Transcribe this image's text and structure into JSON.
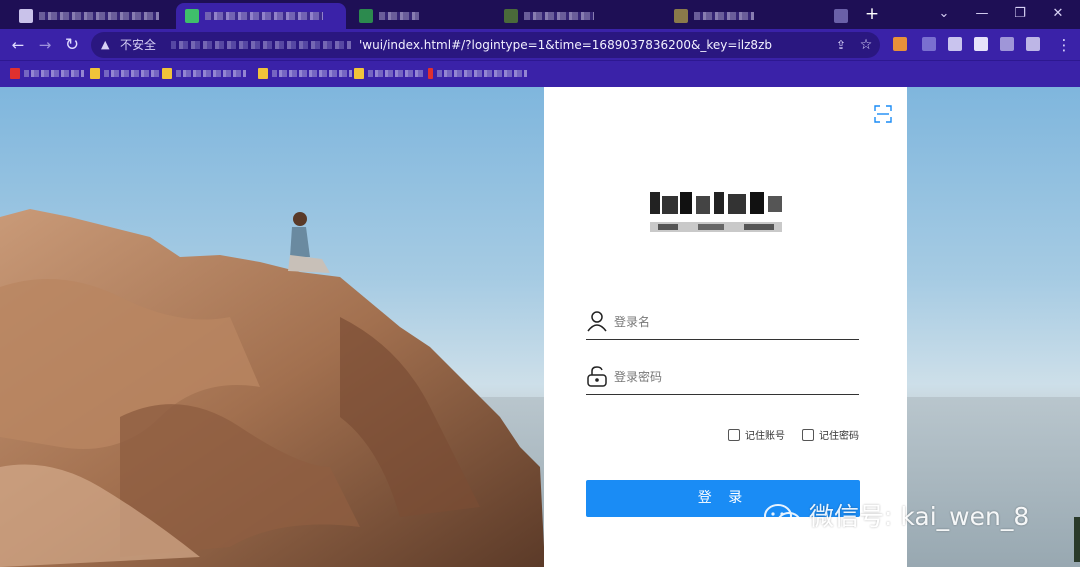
{
  "browser": {
    "tabs": [
      {
        "label": "",
        "active": false
      },
      {
        "label": "",
        "active": true
      },
      {
        "label": "",
        "active": false
      },
      {
        "label": "",
        "active": false
      },
      {
        "label": "",
        "active": false
      },
      {
        "label": "",
        "active": false
      }
    ],
    "new_tab_symbol": "+",
    "window_controls": [
      "⌄",
      "—",
      "❐",
      "✕"
    ],
    "security_label": "不安全",
    "url": "'wui/index.html#/?logintype=1&time=1689037836200&_key=ilz8zb",
    "nav": {
      "back": "←",
      "forward": "→",
      "reload": "↻"
    }
  },
  "login": {
    "username_placeholder": "登录名",
    "password_placeholder": "登录密码",
    "remember_account_label": "记住账号",
    "remember_password_label": "记住密码",
    "login_button_label": "登 录",
    "icons": [
      "scan-icon",
      "user-icon",
      "lock-icon"
    ]
  },
  "watermark": {
    "text": "微信号: kai_wen_8"
  },
  "colors": {
    "tab_bar": "#1e0f55",
    "toolbar": "#3a22a8",
    "primary_button": "#1a8cf5",
    "panel_bg": "#ffffff"
  }
}
